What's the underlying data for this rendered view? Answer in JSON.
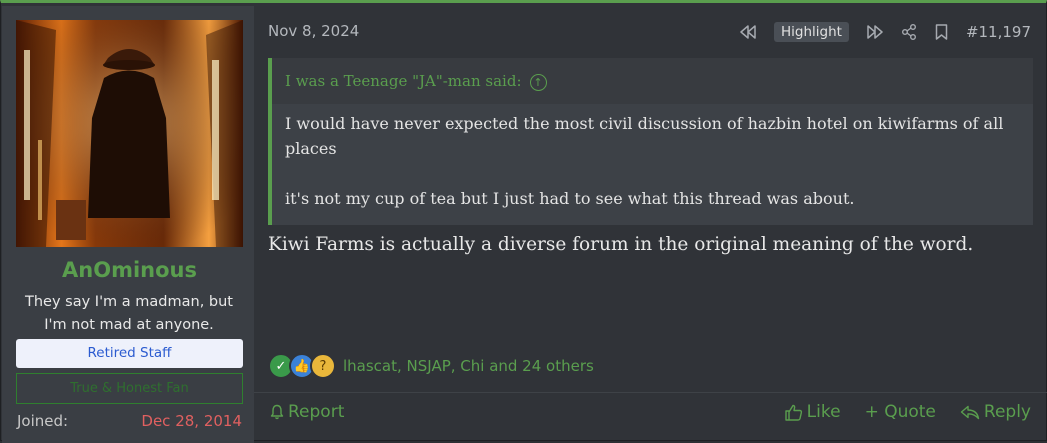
{
  "user": {
    "name": "AnOminous",
    "title_line1": "They say I'm a madman, but",
    "title_line2": "I'm not mad at anyone.",
    "badge_staff": "Retired Staff",
    "badge_honest": "True & Honest Fan",
    "joined_label": "Joined:",
    "joined_value": "Dec 28, 2014"
  },
  "post": {
    "date": "Nov 8, 2024",
    "highlight": "Highlight",
    "number": "#11,197",
    "quote_author": "I was a Teenage \"JA\"-man said:",
    "quote_p1": "I would have never expected the most civil discussion of hazbin hotel on kiwifarms of all places",
    "quote_p2": "it's not my cup of tea but I just had to see what this thread was about.",
    "message": "Kiwi Farms is actually a diverse forum in the original meaning of the word.",
    "reactions_users": "lhascat, NSJAP, Chi and 24 others"
  },
  "footer": {
    "report": "Report",
    "like": "Like",
    "quote": "+ Quote",
    "reply": "Reply"
  },
  "colors": {
    "accent": "#5a9e4e",
    "joined_date": "#e06060",
    "staff_badge_text": "#2b5bd0"
  },
  "icons": [
    "rewind-icon",
    "fast-forward-icon",
    "share-icon",
    "bookmark-icon",
    "arrow-up-circle-icon",
    "checkmark-reaction-icon",
    "thumbs-up-reaction-icon",
    "thinking-reaction-icon",
    "bell-icon",
    "thumbs-up-icon",
    "reply-icon"
  ]
}
